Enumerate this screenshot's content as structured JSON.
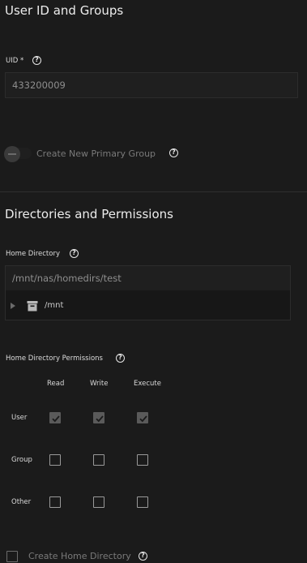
{
  "user_group_section": {
    "title": "User ID and Groups",
    "uid_label": "UID *",
    "uid_value": "433200009",
    "create_group_label": "Create New Primary Group",
    "create_group_enabled": false
  },
  "directories_section": {
    "title": "Directories and Permissions",
    "home_dir_label": "Home Directory",
    "home_dir_value": "/mnt/nas/homedirs/test",
    "tree_root": "/mnt",
    "permissions_label": "Home Directory Permissions",
    "columns": [
      "Read",
      "Write",
      "Execute"
    ],
    "rows": [
      {
        "label": "User",
        "read": true,
        "write": true,
        "execute": true
      },
      {
        "label": "Group",
        "read": false,
        "write": false,
        "execute": false
      },
      {
        "label": "Other",
        "read": false,
        "write": false,
        "execute": false
      }
    ],
    "create_home_label": "Create Home Directory",
    "create_home_checked": false
  },
  "icons": {
    "help": "help-circle-icon",
    "folder": "folder-icon",
    "expand": "expand-arrow-icon"
  },
  "colors": {
    "background": "#1b1b1b",
    "checked_box": "#5a5a5a",
    "muted_text": "#7a7a7a"
  }
}
